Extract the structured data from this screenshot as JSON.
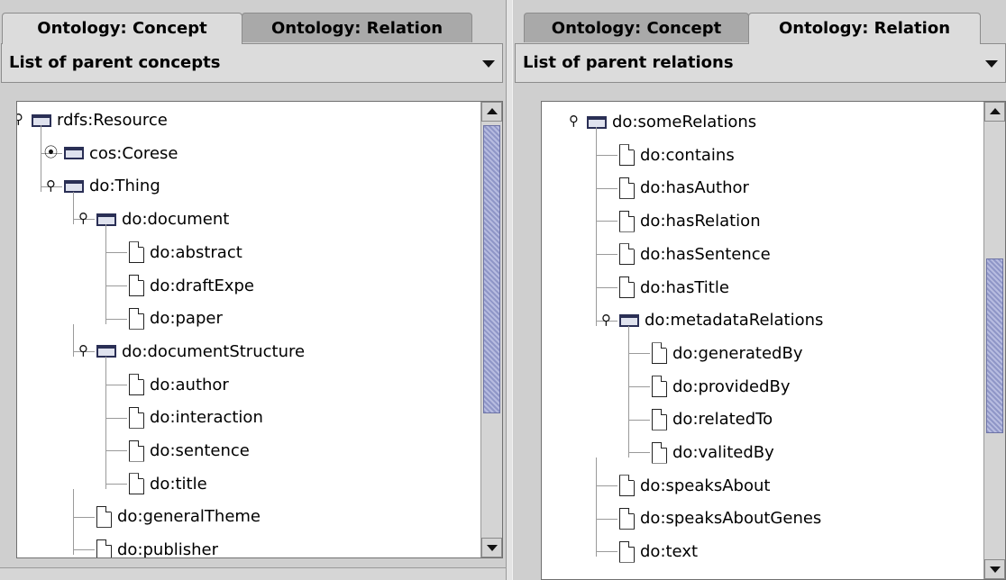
{
  "left_panel": {
    "tabs": [
      {
        "label": "Ontology: Concept",
        "selected": true
      },
      {
        "label": "Ontology: Relation",
        "selected": false
      }
    ],
    "combo_label": "List of parent concepts",
    "tree": [
      {
        "label": "rdfs:Resource",
        "type": "folder",
        "expanded": true,
        "depth": 0
      },
      {
        "label": "cos:Corese",
        "type": "folder",
        "expanded": false,
        "depth": 1
      },
      {
        "label": "do:Thing",
        "type": "folder",
        "expanded": true,
        "depth": 1
      },
      {
        "label": "do:document",
        "type": "folder",
        "expanded": true,
        "depth": 2
      },
      {
        "label": "do:abstract",
        "type": "leaf",
        "depth": 3
      },
      {
        "label": "do:draftExpe",
        "type": "leaf",
        "depth": 3
      },
      {
        "label": "do:paper",
        "type": "leaf",
        "depth": 3
      },
      {
        "label": "do:documentStructure",
        "type": "folder",
        "expanded": true,
        "depth": 2
      },
      {
        "label": "do:author",
        "type": "leaf",
        "depth": 3
      },
      {
        "label": "do:interaction",
        "type": "leaf",
        "depth": 3
      },
      {
        "label": "do:sentence",
        "type": "leaf",
        "depth": 3
      },
      {
        "label": "do:title",
        "type": "leaf",
        "depth": 3
      },
      {
        "label": "do:generalTheme",
        "type": "leaf",
        "depth": 2
      },
      {
        "label": "do:publisher",
        "type": "leaf",
        "depth": 2
      }
    ]
  },
  "right_panel": {
    "tabs": [
      {
        "label": "Ontology: Concept",
        "selected": false
      },
      {
        "label": "Ontology: Relation",
        "selected": true
      }
    ],
    "combo_label": "List of parent relations",
    "tree": [
      {
        "label": "do:someRelations",
        "type": "folder",
        "expanded": true,
        "depth": 0
      },
      {
        "label": "do:contains",
        "type": "leaf",
        "depth": 1
      },
      {
        "label": "do:hasAuthor",
        "type": "leaf",
        "depth": 1
      },
      {
        "label": "do:hasRelation",
        "type": "leaf",
        "depth": 1
      },
      {
        "label": "do:hasSentence",
        "type": "leaf",
        "depth": 1
      },
      {
        "label": "do:hasTitle",
        "type": "leaf",
        "depth": 1
      },
      {
        "label": "do:metadataRelations",
        "type": "folder",
        "expanded": true,
        "depth": 1
      },
      {
        "label": "do:generatedBy",
        "type": "leaf",
        "depth": 2
      },
      {
        "label": "do:providedBy",
        "type": "leaf",
        "depth": 2
      },
      {
        "label": "do:relatedTo",
        "type": "leaf",
        "depth": 2
      },
      {
        "label": "do:valitedBy",
        "type": "leaf",
        "depth": 2
      },
      {
        "label": "do:speaksAbout",
        "type": "leaf",
        "depth": 1
      },
      {
        "label": "do:speaksAboutGenes",
        "type": "leaf",
        "depth": 1
      },
      {
        "label": "do:text",
        "type": "leaf",
        "depth": 1
      }
    ]
  },
  "colors": {
    "thumb": "#9ea4d2",
    "selected_tab": "#dcdcdc",
    "unselected_tab": "#a9a9a9"
  }
}
